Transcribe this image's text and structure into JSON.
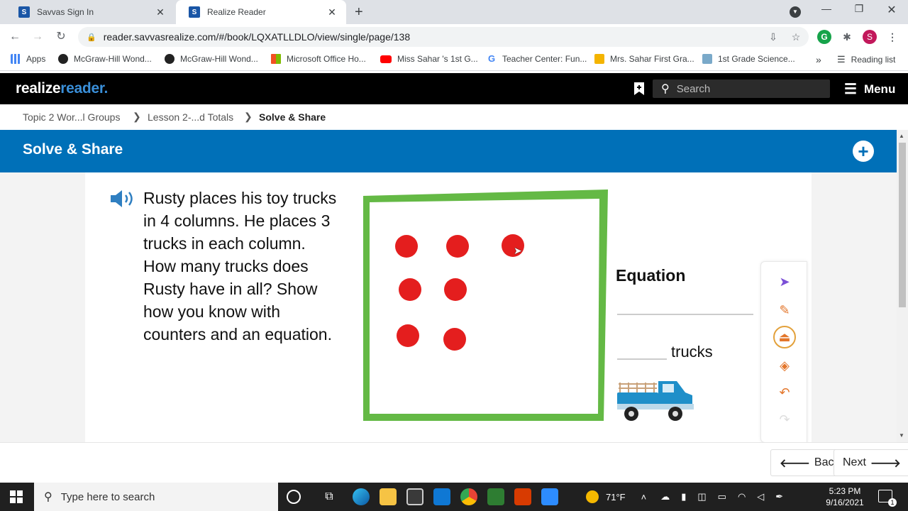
{
  "browser": {
    "tabs": [
      {
        "title": "Savvas Sign In",
        "icon": "savvas-favicon"
      },
      {
        "title": "Realize Reader",
        "icon": "savvas-favicon"
      }
    ],
    "new_tab": "+",
    "url": "reader.savvasrealize.com/#/book/LQXATLLDLO/view/single/page/138",
    "profile_initial": "S",
    "bookmarks": [
      {
        "label": "Apps",
        "icon": "apps-grid-icon",
        "color": "#4285f4"
      },
      {
        "label": "McGraw-Hill Wond...",
        "icon": "globe-icon",
        "color": "#222222"
      },
      {
        "label": "McGraw-Hill Wond...",
        "icon": "globe-icon",
        "color": "#222222"
      },
      {
        "label": "Microsoft Office Ho...",
        "icon": "office-icon",
        "color": "#d83b01"
      },
      {
        "label": "Miss Sahar 's 1st G...",
        "icon": "youtube-icon",
        "color": "#ff0000"
      },
      {
        "label": "Teacher Center: Fun...",
        "icon": "google-icon",
        "color": "#4285f4"
      },
      {
        "label": "Mrs. Sahar First Gra...",
        "icon": "classroom-icon",
        "color": "#f4b400"
      },
      {
        "label": "1st Grade Science...",
        "icon": "folder-icon",
        "color": "#7aa9c9"
      }
    ],
    "more_bookmarks": "»",
    "reading_list": "Reading list"
  },
  "app": {
    "logo_part1": "realize",
    "logo_part2": "reader.",
    "search_placeholder": "Search",
    "menu_label": "Menu"
  },
  "breadcrumb": {
    "items": [
      "Topic 2 Wor...l Groups",
      "Lesson 2-...d Totals",
      "Solve & Share"
    ],
    "separator": "❯"
  },
  "title": "Solve & Share",
  "lesson": {
    "prompt": "Rusty places his toy trucks in 4 columns. He places 3 trucks in each column. How many trucks does Rusty have in all? Show how you know with counters and an equation.",
    "equation_label": "Equation",
    "trucks_label": "trucks",
    "counter_count": 7,
    "counter_color": "#e41e1e",
    "frame_color": "#64b945"
  },
  "tools": [
    "pointer-tool",
    "pencil-tool",
    "stamp-tool",
    "eraser-tool",
    "undo-tool",
    "redo-tool"
  ],
  "nav": {
    "back": "Back",
    "next": "Next"
  },
  "taskbar": {
    "search_placeholder": "Type here to search",
    "weather": "71°F",
    "time": "5:23 PM",
    "date": "9/16/2021",
    "notification_count": "1"
  },
  "colors": {
    "title_bar": "#0070b8",
    "header_bg": "#000000",
    "logo_accent": "#3a8fd9"
  }
}
